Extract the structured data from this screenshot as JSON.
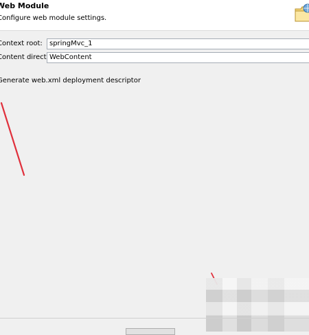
{
  "banner": {
    "title": "Web Module",
    "description": "Configure web module settings.",
    "icon": "folder-web-icon"
  },
  "form": {
    "context_root": {
      "label": "Context root:",
      "value": "springMvc_1"
    },
    "content_directory": {
      "label": "Content directory:",
      "value": "WebContent"
    },
    "generate_descriptor": {
      "label": "Generate web.xml deployment descriptor",
      "checked": false
    }
  },
  "colors": {
    "annotation_red": "#e0303c",
    "banner_bg": "#ffffff",
    "page_bg": "#f0f0f0"
  }
}
